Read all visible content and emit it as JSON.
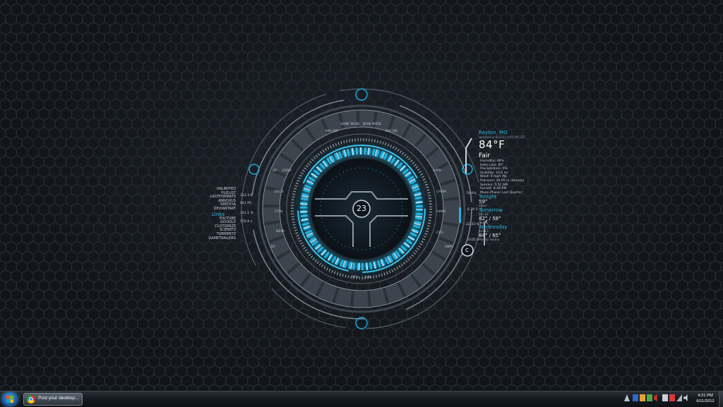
{
  "hud": {
    "top_buttons": [
      "ANY OFF",
      "GAME MODE",
      "DESK MODE",
      "ANY ON"
    ],
    "left_buttons": [
      "UP",
      "CORP",
      "DOCS",
      "CTRL",
      "DESK",
      "DT"
    ],
    "right_buttons": [
      "APPS",
      "CHRM",
      "GAME",
      "CFG",
      "UNPC"
    ],
    "bottom_buttons": [
      "XTH",
      "JUN"
    ],
    "left_numbers": [
      "333.3 B",
      "941 PS",
      "341.1 %",
      "578.8 s"
    ],
    "right_numbers": [
      "74.6%",
      "6.70 S",
      "22.33 %",
      "3335.0"
    ],
    "center_number": "23",
    "c_button": "C"
  },
  "links": {
    "top_items": [
      "UNLIMITED",
      "FILELIST",
      "LASTFORMATS",
      "ANNOVUS",
      "SPATICIA",
      "DEVIANTART"
    ],
    "title": "Links",
    "bottom_items": [
      "YOUTUBE",
      "GOOGLE",
      "CUSTOMIZE",
      "SCENEFZ",
      "TORRENTZ",
      "GAMETRAILERS"
    ]
  },
  "weather": {
    "city": "Rayton, MO",
    "updated": "Updated at 6/11/12 4:05 PM CST",
    "temp": "84°F",
    "condition": "Fair",
    "details": [
      "Humidity: 48%",
      "Feels Like: 85°",
      "Precipitation: 0%",
      "Visibility: 10.0 mi",
      "Wind: 0 mph (N)",
      "Pressure: 29.95 in (Steady)",
      "Sunrise: 5:52 AM",
      "Sunset: 8:44 PM",
      "Moon Phase: Last Quarter"
    ],
    "tonight": {
      "label": "Tonight",
      "temp": "59°",
      "cond": "Clear"
    },
    "tomorrow": {
      "label": "Tomorrow",
      "date": "Jun 12",
      "temp": "82° / 58°",
      "cond": "Sunny"
    },
    "wednesday": {
      "label": "Wednesday",
      "date": "Jun 13",
      "temp": "84° / 65°",
      "cond": "Mostly Sunny"
    }
  },
  "taskbar": {
    "task_label": "Post your desktop...",
    "time": "4:21 PM",
    "date": "6/11/2012"
  },
  "colors": {
    "accent": "#2fb6d8",
    "ring": "#1aa0d0",
    "background": "#111418"
  }
}
